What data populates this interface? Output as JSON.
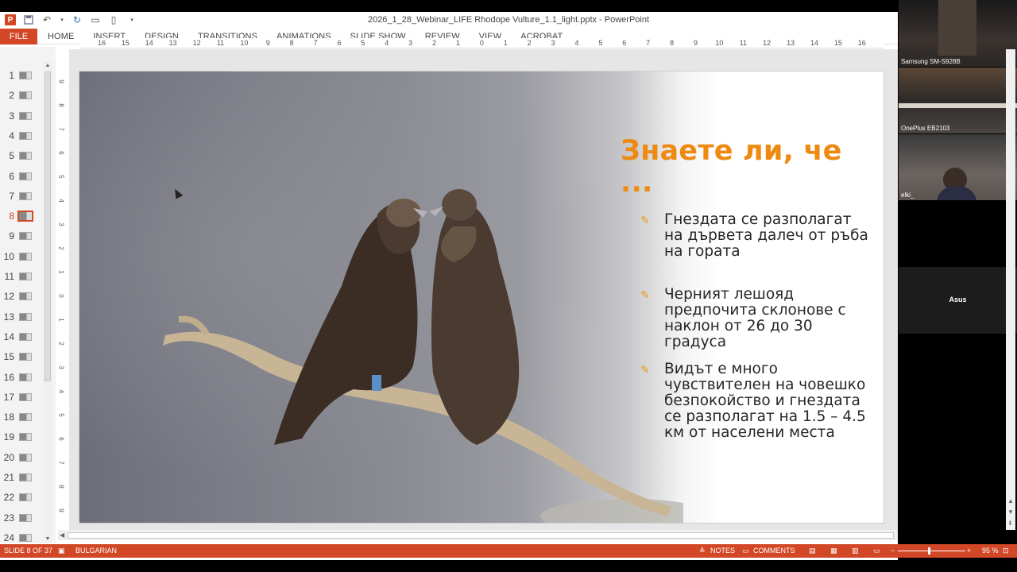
{
  "window": {
    "title": "2026_1_28_Webinar_LIFE Rhodope Vulture_1.1_light.pptx - PowerPoint",
    "app_logo": "P",
    "accent_color": "#d24726"
  },
  "ribbon": {
    "file_label": "FILE",
    "tabs": [
      "HOME",
      "INSERT",
      "DESIGN",
      "TRANSITIONS",
      "ANIMATIONS",
      "SLIDE SHOW",
      "REVIEW",
      "VIEW",
      "ACROBAT"
    ]
  },
  "thumbnails": {
    "numbers": [
      "1",
      "2",
      "3",
      "4",
      "5",
      "6",
      "7",
      "8",
      "9",
      "10",
      "11",
      "12",
      "13",
      "14",
      "15",
      "16",
      "17",
      "18",
      "19",
      "20",
      "21",
      "22",
      "23",
      "24"
    ],
    "active": "8"
  },
  "ruler": {
    "h_labels": [
      "16",
      "15",
      "14",
      "13",
      "12",
      "11",
      "10",
      "9",
      "8",
      "7",
      "6",
      "5",
      "4",
      "3",
      "2",
      "1",
      "0",
      "1",
      "2",
      "3",
      "4",
      "5",
      "6",
      "7",
      "8",
      "9",
      "10",
      "11",
      "12",
      "13",
      "14",
      "15",
      "16"
    ],
    "v_labels": [
      "9",
      "8",
      "7",
      "6",
      "5",
      "4",
      "3",
      "2",
      "1",
      "0",
      "1",
      "2",
      "3",
      "4",
      "5",
      "6",
      "7",
      "8",
      "9"
    ]
  },
  "slide": {
    "title": "Знаете ли, че ...",
    "title_color": "#ee8a12",
    "bullet_icon": "pencil-icon",
    "bullets": [
      "Гнездата се разполагат на дървета далеч от ръба на гората",
      "Черният лешояд предпочита склонове с наклон от 26 до 30 градуса",
      "Видът е много чувствителен на човешко безпокойство и гнездата се разполагат на 1.5 – 4.5 км от населени места"
    ]
  },
  "statusbar": {
    "slide_info": "SLIDE 8 OF 37",
    "language": "BULGARIAN",
    "notes": "NOTES",
    "comments": "COMMENTS",
    "zoom": "95 %",
    "minus": "−",
    "plus": "+"
  },
  "participants": [
    {
      "name": "Samsung SM-S928B"
    },
    {
      "name": "OnePlus EB2103"
    },
    {
      "name": "elki_"
    },
    {
      "name": "Asus"
    }
  ]
}
